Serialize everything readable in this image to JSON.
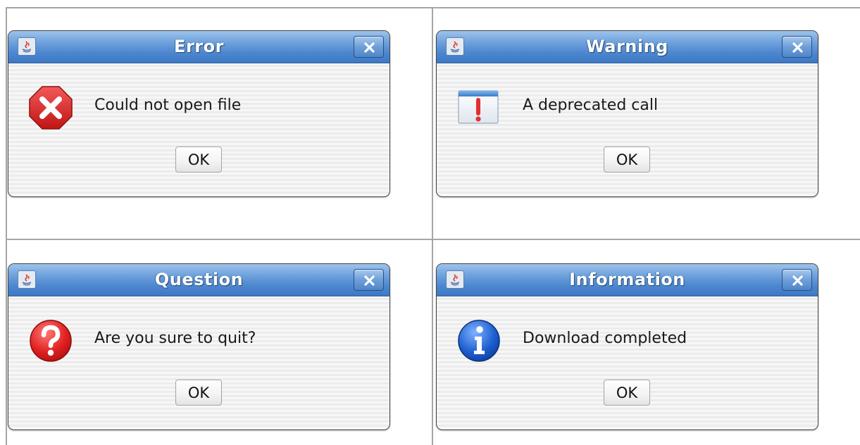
{
  "dialogs": [
    {
      "title": "Error",
      "message": "Could not open file",
      "ok_label": "OK",
      "icon": "error-icon"
    },
    {
      "title": "Warning",
      "message": "A deprecated call",
      "ok_label": "OK",
      "icon": "warning-icon"
    },
    {
      "title": "Question",
      "message": "Are you sure to quit?",
      "ok_label": "OK",
      "icon": "question-icon"
    },
    {
      "title": "Information",
      "message": "Download completed",
      "ok_label": "OK",
      "icon": "information-icon"
    }
  ],
  "colors": {
    "titlebar_blue": "#4c86cf",
    "error_red": "#d42323",
    "question_red": "#e02020",
    "info_blue": "#1e5fd0",
    "warning_red": "#e03030"
  }
}
